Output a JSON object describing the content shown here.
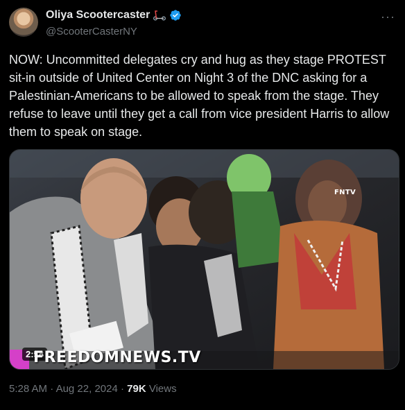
{
  "author": {
    "display_name": "Oliya Scootercaster",
    "handle": "@ScooterCasterNY"
  },
  "post": {
    "text": "NOW: Uncommitted delegates cry and hug as they stage PROTEST sit-in outside of United Center on Night 3 of the DNC asking for a Palestinian-Americans to be allowed to speak from the stage. They refuse to leave until they get a call from vice president Harris to allow them to speak on stage."
  },
  "media": {
    "duration": "2:58",
    "watermark_top": "FNTV",
    "watermark_bottom": "FREEDOMNEWS.TV"
  },
  "meta": {
    "time": "5:28 AM",
    "separator": " · ",
    "date": "Aug 22, 2024",
    "views_count": "79K",
    "views_label": " Views"
  },
  "icons": {
    "more": "more-icon",
    "verified": "verified-icon",
    "scooter": "scooter-icon"
  },
  "colors": {
    "background": "#000000",
    "text": "#e7e9ea",
    "muted": "#71767b",
    "verified_blue": "#1d9bf0",
    "accent_pink": "#d540c8"
  }
}
